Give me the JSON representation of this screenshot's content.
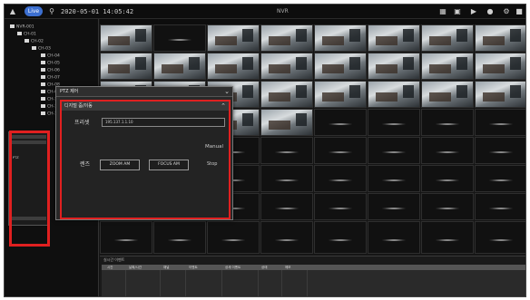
{
  "topbar": {
    "live_tab": "Live",
    "datetime": "2020-05-01  14:05:42",
    "title": "NVR"
  },
  "tree": {
    "items": [
      "NVR-001",
      "CH-01",
      "CH-02",
      "CH-03",
      "CH-04",
      "CH-05",
      "CH-06",
      "CH-07",
      "CH-08",
      "CH-09",
      "CH-10",
      "CH-11",
      "CH-12"
    ]
  },
  "dialog": {
    "title": "PTZ 제어",
    "section_title": "디지털 줌/이동",
    "preset_label": "프리셋",
    "preset_value": "195.137.1.1.10",
    "manual_label": "Manual",
    "lens_label": "렌즈",
    "zoom_button": "ZOOM AM",
    "focus_button": "FOCUS AM",
    "stop_label": "Stop"
  },
  "side_panel": {
    "row_label": "PTZ"
  },
  "log": {
    "title": "실시간 이벤트",
    "columns": [
      "시간",
      "날짜/시간",
      "채널",
      "이벤트",
      "상세 이벤트",
      "상태",
      "메모"
    ]
  },
  "colors": {
    "accent": "#3c6fd0",
    "highlight": "#e02020",
    "background": "#151515"
  }
}
